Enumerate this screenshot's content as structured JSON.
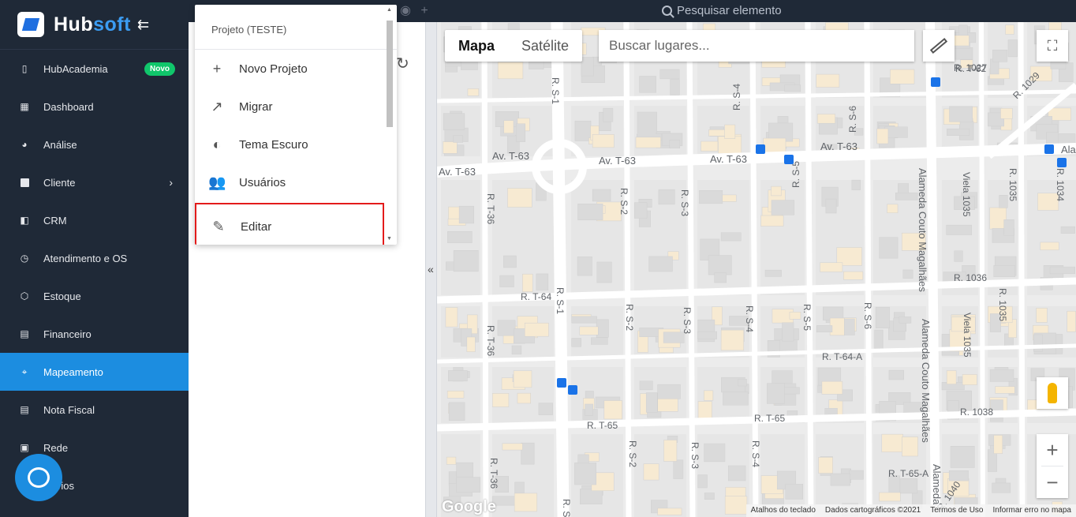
{
  "sidebar": {
    "brand": {
      "part1": "Hub",
      "part2": "soft"
    },
    "collapse_icon": "arrow-left-icon",
    "items": [
      {
        "label": "HubAcademia",
        "icon": "book-icon",
        "badge": "Novo"
      },
      {
        "label": "Dashboard",
        "icon": "grid-icon"
      },
      {
        "label": "Análise",
        "icon": "pie-icon"
      },
      {
        "label": "Cliente",
        "icon": "card-icon",
        "has_submenu": true
      },
      {
        "label": "CRM",
        "icon": "board-icon"
      },
      {
        "label": "Atendimento e OS",
        "icon": "calendar-clock-icon"
      },
      {
        "label": "Estoque",
        "icon": "box-icon"
      },
      {
        "label": "Financeiro",
        "icon": "money-icon"
      },
      {
        "label": "Mapeamento",
        "icon": "map-pin-icon",
        "active": true
      },
      {
        "label": "Nota Fiscal",
        "icon": "receipt-icon"
      },
      {
        "label": "Rede",
        "icon": "network-icon"
      },
      {
        "label": "atórios",
        "icon": "report-icon"
      }
    ]
  },
  "topbar": {
    "search_placeholder": "Pesquisar elemento"
  },
  "project_menu": {
    "header": "Projeto (TESTE)",
    "items": [
      {
        "label": "Novo Projeto",
        "icon": "plus-icon"
      },
      {
        "label": "Migrar",
        "icon": "arrow-up-right-icon"
      },
      {
        "label": "Tema Escuro",
        "icon": "brightness-icon"
      },
      {
        "label": "Usuários",
        "icon": "people-icon"
      },
      {
        "label": "Editar",
        "icon": "pencil-icon",
        "selected": true
      }
    ]
  },
  "map": {
    "view_toggle": [
      "Mapa",
      "Satélite"
    ],
    "active_view": "Mapa",
    "search_placeholder": "Buscar lugares...",
    "google_logo": "Google",
    "attribution": [
      "Atalhos do teclado",
      "Dados cartográficos ©2021",
      "Termos de Uso",
      "Informar erro no mapa"
    ],
    "street_labels": [
      "R. T-62",
      "R. 1027",
      "R. 1029",
      "R. S-1",
      "R. S-4",
      "R. S-6",
      "Av. T-63",
      "Av. T-63",
      "Av. T-63",
      "Av. T-63",
      "Av. T-63",
      "Ala",
      "R. T-36",
      "R. S-2",
      "R. S-3",
      "R. S-5",
      "Viela 1035",
      "R. 1035",
      "R. 1034",
      "Alameda Couto Magalhães",
      "R. 1036",
      "R. T-64",
      "R. S-1",
      "R. S-2",
      "R. S-3",
      "R. S-4",
      "R. S-5",
      "R. S-6",
      "R. T-36",
      "R. T-64-A",
      "Viela 1035",
      "R. 1035",
      "Alameda Couto Magalhães",
      "R. T-65",
      "R. T-65",
      "R. 1038",
      "R. S-2",
      "R. S-3",
      "R. S-4",
      "R. T-36",
      "R. T-65-A",
      "R. S-",
      "R. 1040",
      "Alameda"
    ]
  },
  "colors": {
    "sidebar_bg": "#1f2937",
    "accent": "#1c8de0",
    "badge_green": "#10c66b",
    "highlight_red": "#e31b1b"
  }
}
